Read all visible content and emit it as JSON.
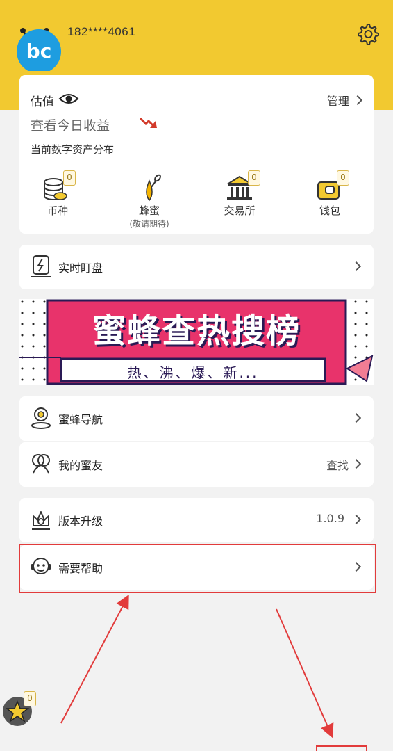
{
  "header": {
    "phone": "182****4061",
    "avatar_text": "bc"
  },
  "asset_card": {
    "title": "估值",
    "manage_label": "管理",
    "earnings_label": "查看今日收益",
    "distribution_label": "当前数字资产分布",
    "items": [
      {
        "label": "币种",
        "badge": "0",
        "icon": "coins-icon"
      },
      {
        "label": "蜂蜜",
        "sub": "(敬请期待)",
        "icon": "honey-icon"
      },
      {
        "label": "交易所",
        "badge": "0",
        "icon": "exchange-icon"
      },
      {
        "label": "钱包",
        "badge": "0",
        "icon": "wallet-icon"
      }
    ]
  },
  "realtime": {
    "label": "实时盯盘"
  },
  "banner": {
    "title": "蜜蜂查热搜榜",
    "subtitle": "热、沸、爆、新..."
  },
  "nav": {
    "label": "蜜蜂导航"
  },
  "friends": {
    "label": "我的蜜友",
    "right": "查找"
  },
  "upgrade": {
    "label": "版本升级",
    "version": "1.0.9"
  },
  "help": {
    "label": "需要帮助"
  },
  "floating": {
    "badge": "0"
  },
  "colors": {
    "brand_yellow": "#f2c930",
    "banner_pink": "#e8336b",
    "annotation_red": "#e23b3b"
  }
}
